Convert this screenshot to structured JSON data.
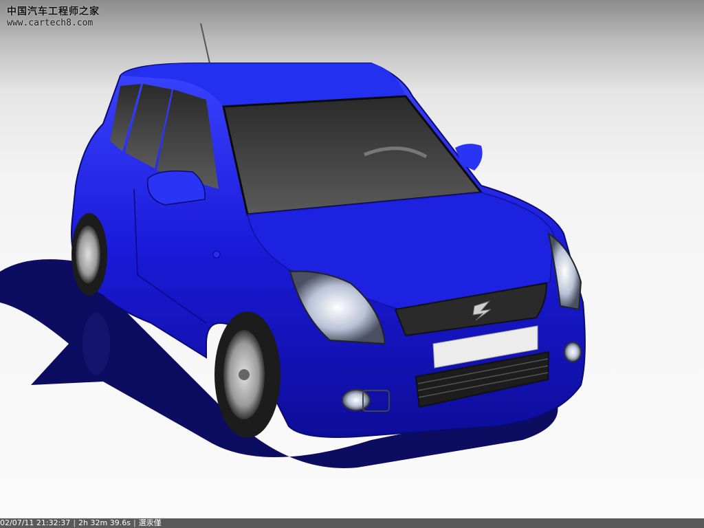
{
  "watermark": {
    "title": "中国汽车工程师之家",
    "url": "www.cartech8.com"
  },
  "status": {
    "date_time": "02/07/11 21:32:37",
    "render_time": "2h 32m 39.6s",
    "label": "選汞僅"
  },
  "colors": {
    "body_paint": "#1a1ad8",
    "body_highlight": "#4a5cff",
    "shadow": "#0c0c60",
    "background": "#f4f4f4",
    "status_bar": "#5a5a5a"
  },
  "icons": {
    "logo": "suzuki-s-emblem"
  }
}
